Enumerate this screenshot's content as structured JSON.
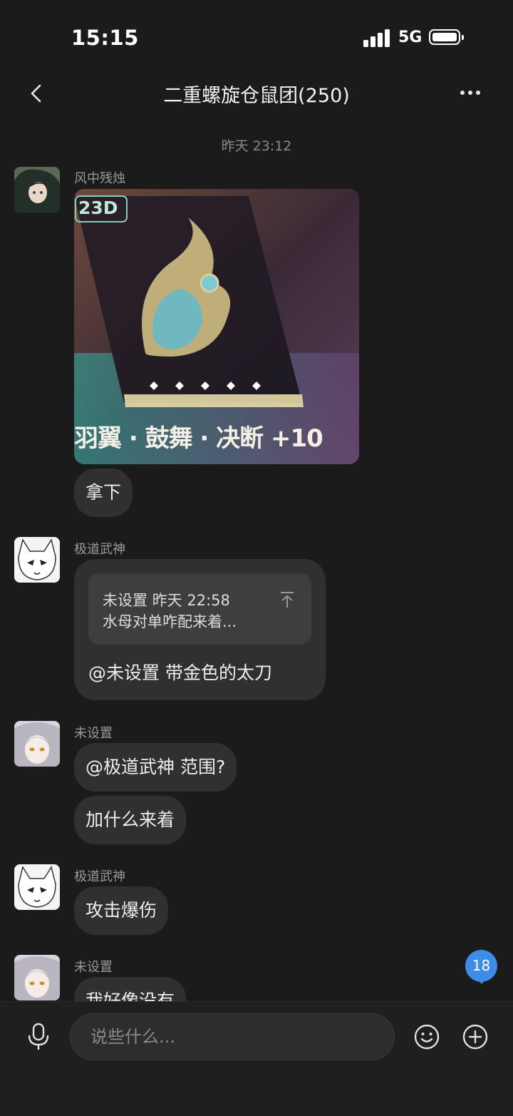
{
  "status_bar": {
    "time": "15:15",
    "network": "5G"
  },
  "header": {
    "title": "二重螺旋仓鼠团(250)"
  },
  "timestamp": "昨天 23:12",
  "messages": [
    {
      "sender": "风中残烛",
      "image_badge": "23D",
      "image_caption": "羽翼 · 鼓舞 · 决断 +10",
      "text": "拿下"
    },
    {
      "sender": "极道武神",
      "quote_meta": "未设置 昨天 22:58",
      "quote_text": "水母对单咋配来着...",
      "text": "@未设置 带金色的太刀"
    },
    {
      "sender": "未设置",
      "text": "@极道武神 范围?",
      "text2": "加什么来着"
    },
    {
      "sender": "极道武神",
      "text": "攻击爆伤"
    },
    {
      "sender": "未设置",
      "text": "我好像没有"
    }
  ],
  "unread_badge": "18",
  "input": {
    "placeholder": "说些什么..."
  },
  "colors": {
    "background": "#1b1b1b",
    "bubble": "#303030",
    "badge": "#3d8ce6"
  }
}
